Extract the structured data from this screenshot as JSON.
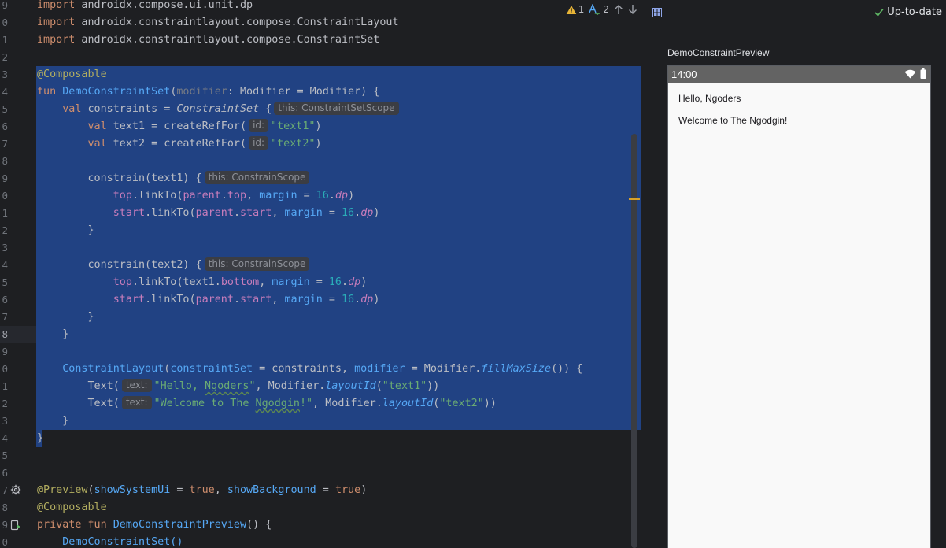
{
  "editor": {
    "line_numbers": [
      "9",
      "0",
      "1",
      "2",
      "3",
      "4",
      "5",
      "6",
      "7",
      "8",
      "9",
      "0",
      "1",
      "2",
      "3",
      "4",
      "5",
      "6",
      "7",
      "8",
      "9",
      "0",
      "1",
      "2",
      "3",
      "4",
      "5",
      "6",
      "7",
      "8",
      "9",
      "0"
    ],
    "lines": {
      "l0_kw": "import",
      "l0_rest": " androidx.compose.ui.unit.dp",
      "l1_kw": "import",
      "l1_rest": " androidx.constraintlayout.compose.ConstraintLayout",
      "l2_kw": "import",
      "l2_rest": " androidx.constraintlayout.compose.ConstraintSet",
      "l4_ann": "@Composable",
      "l5_kw": "fun ",
      "l5_fn": "DemoConstraintSet",
      "l5_p1": "(",
      "l5_param": "modifier",
      "l5_rest": ": Modifier = Modifier) {",
      "l6_kw": "    val ",
      "l6_a": "constraints = ",
      "l6_cls": "ConstraintSet",
      "l6_b": " {",
      "l6_hint": "this: ConstraintSetScope",
      "l7_kw": "        val ",
      "l7_a": "text1 = createRefFor(",
      "l7_hint": "id:",
      "l7_str": "\"text1\"",
      "l7_b": ")",
      "l8_kw": "        val ",
      "l8_a": "text2 = createRefFor(",
      "l8_hint": "id:",
      "l8_str": "\"text2\"",
      "l8_b": ")",
      "l10_a": "        constrain(text1) {",
      "l10_hint": "this: ConstrainScope",
      "l11_pre": "            ",
      "l11_p1": "top",
      "l11_a": ".linkTo(",
      "l11_p2": "parent",
      "l11_b": ".",
      "l11_p3": "top",
      "l11_c": ", ",
      "l11_n": "margin",
      "l11_d": " = ",
      "l11_num": "16",
      "l11_e": ".",
      "l11_dp": "dp",
      "l11_f": ")",
      "l12_pre": "            ",
      "l12_p1": "start",
      "l12_a": ".linkTo(",
      "l12_p2": "parent",
      "l12_b": ".",
      "l12_p3": "start",
      "l12_c": ", ",
      "l12_n": "margin",
      "l12_d": " = ",
      "l12_num": "16",
      "l12_e": ".",
      "l12_dp": "dp",
      "l12_f": ")",
      "l13": "        }",
      "l15_a": "        constrain(text2) {",
      "l15_hint": "this: ConstrainScope",
      "l16_pre": "            ",
      "l16_p1": "top",
      "l16_a": ".linkTo(text1.",
      "l16_p3": "bottom",
      "l16_c": ", ",
      "l16_n": "margin",
      "l16_d": " = ",
      "l16_num": "16",
      "l16_e": ".",
      "l16_dp": "dp",
      "l16_f": ")",
      "l17_pre": "            ",
      "l17_p1": "start",
      "l17_a": ".linkTo(",
      "l17_p2": "parent",
      "l17_b": ".",
      "l17_p3": "start",
      "l17_c": ", ",
      "l17_n": "margin",
      "l17_d": " = ",
      "l17_num": "16",
      "l17_e": ".",
      "l17_dp": "dp",
      "l17_f": ")",
      "l18": "        }",
      "l19": "    }",
      "l21_pre": "    ",
      "l21_fn": "ConstraintLayout",
      "l21_a": "(",
      "l21_n1": "constraintSet",
      "l21_b": " = constraints, ",
      "l21_n2": "modifier",
      "l21_c": " = Modifier.",
      "l21_it": "fillMaxSize",
      "l21_d": "()) {",
      "l22_pre": "        ",
      "l22_a": "Text(",
      "l22_hint": "text:",
      "l22_s1": "\"Hello, ",
      "l22_typo": "Ngoders",
      "l22_s2": "\"",
      "l22_b": ", Modifier.",
      "l22_it": "layoutId",
      "l22_c": "(",
      "l22_str": "\"text1\"",
      "l22_d": "))",
      "l23_pre": "        ",
      "l23_a": "Text(",
      "l23_hint": "text:",
      "l23_s1": "\"Welcome to The ",
      "l23_typo": "Ngodgin",
      "l23_s2": "!\"",
      "l23_b": ", Modifier.",
      "l23_it": "layoutId",
      "l23_c": "(",
      "l23_str": "\"text2\"",
      "l23_d": "))",
      "l24": "    }",
      "l25": "}",
      "l28_ann": "@Preview",
      "l28_a": "(",
      "l28_n1": "showSystemUi",
      "l28_b": " = ",
      "l28_t1": "true",
      "l28_c": ", ",
      "l28_n2": "showBackground",
      "l28_d": " = ",
      "l28_t2": "true",
      "l28_e": ")",
      "l29_ann": "@Composable",
      "l30_kw": "private fun ",
      "l30_fn": "DemoConstraintPreview",
      "l30_a": "() {",
      "l31_pre": "    ",
      "l31_a": "DemoConstraintSet()"
    },
    "inspections": {
      "warnings": "1",
      "typos": "2"
    }
  },
  "preview": {
    "status": "Up-to-date",
    "title": "DemoConstraintPreview",
    "device_time": "14:00",
    "text1": "Hello, Ngoders",
    "text2": "Welcome to The Ngodgin!"
  },
  "colors": {
    "selection": "#214283",
    "warning": "#e7b437",
    "accent": "#56a8f5"
  }
}
